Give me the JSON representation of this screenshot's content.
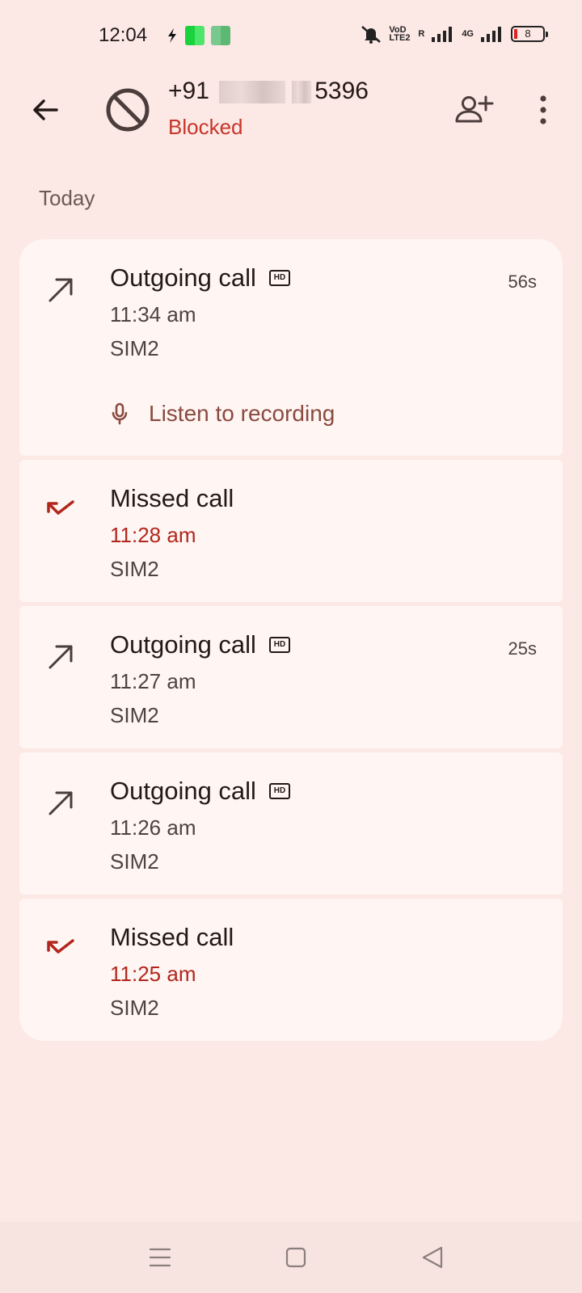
{
  "status_bar": {
    "time": "12:04",
    "network_label": "VoD LTE2",
    "roaming_label": "R",
    "data_label": "4G",
    "battery": "8"
  },
  "header": {
    "number_prefix": "+91",
    "number_suffix": "5396",
    "status": "Blocked",
    "status_color": "#c6352a"
  },
  "section": {
    "label": "Today"
  },
  "calls": [
    {
      "type": "Outgoing call",
      "hd": "HD",
      "time": "11:34 am",
      "sim": "SIM2",
      "duration": "56s",
      "recording": "Listen to recording",
      "icon": "outgoing-arrow-icon"
    },
    {
      "type": "Missed call",
      "time": "11:28 am",
      "sim": "SIM2",
      "icon": "missed-call-icon"
    },
    {
      "type": "Outgoing call",
      "hd": "HD",
      "time": "11:27 am",
      "sim": "SIM2",
      "duration": "25s",
      "icon": "outgoing-arrow-icon"
    },
    {
      "type": "Outgoing call",
      "hd": "HD",
      "time": "11:26 am",
      "sim": "SIM2",
      "icon": "outgoing-arrow-icon"
    },
    {
      "type": "Missed call",
      "time": "11:25 am",
      "sim": "SIM2",
      "icon": "missed-call-icon"
    }
  ],
  "colors": {
    "background": "#fce8e5",
    "card": "#fff5f3",
    "missed": "#b1271d",
    "recording": "#8a4a3f"
  }
}
